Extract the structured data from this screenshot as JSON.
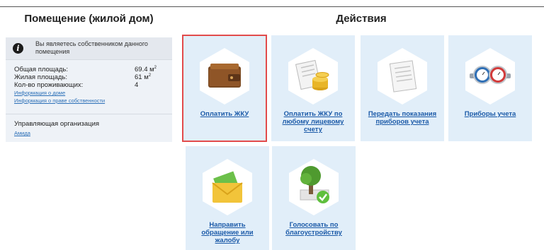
{
  "left_section": {
    "title": "Помещение (жилой дом)",
    "owner_notice": "Вы являетесь собственником данного помещения",
    "area_total_label": "Общая площадь:",
    "area_total_value": "69.4 м",
    "area_living_label": "Жилая площадь:",
    "area_living_value": "61 м",
    "area_unit_exponent": "2",
    "residents_label": "Кол-во проживающих:",
    "residents_value": "4",
    "house_info_link": "Информация о доме",
    "ownership_info_link": "Информация о праве собственности",
    "management_org_label": "Управляющая организация",
    "management_org_link": "Амида"
  },
  "right_section": {
    "title": "Действия",
    "tiles": [
      {
        "label": "Оплатить ЖКУ",
        "icon": "wallet-icon",
        "selected": true
      },
      {
        "label": "Оплатить ЖКУ по любому лицевому счету",
        "icon": "coins-receipt-icon",
        "selected": false
      },
      {
        "label": "Передать показания приборов учета",
        "icon": "receipt-icon",
        "selected": false
      },
      {
        "label": "Приборы учета",
        "icon": "water-meter-icon",
        "selected": false
      },
      {
        "label": "Направить обращение или жалобу",
        "icon": "envelope-icon",
        "selected": false
      },
      {
        "label": "Голосовать по благоустройству",
        "icon": "tree-vote-icon",
        "selected": false
      }
    ]
  },
  "colors": {
    "tile_background": "#e1eef9",
    "link": "#1b5aa8",
    "selected_outline": "#e24b4b",
    "panel_background": "#eef2f7"
  }
}
